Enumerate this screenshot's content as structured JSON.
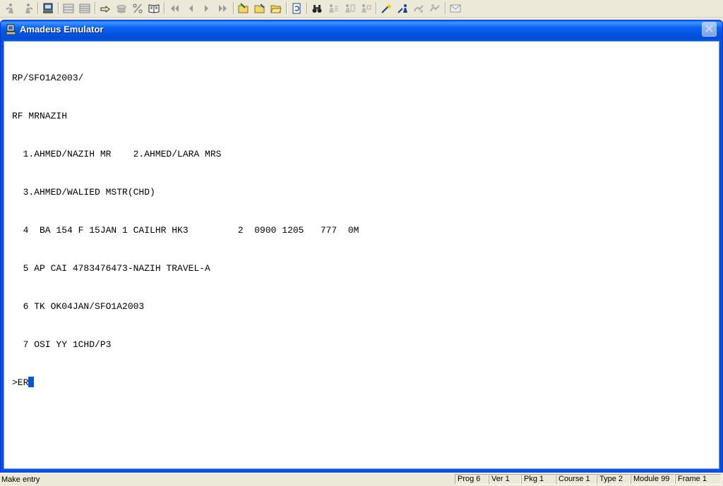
{
  "toolbar": {
    "buttons": [
      {
        "icon": "figure-left-icon"
      },
      {
        "icon": "figure-right-icon"
      },
      {
        "icon": "terminal-icon"
      },
      {
        "icon": "grid-icon"
      },
      {
        "icon": "grid-alt-icon"
      },
      {
        "icon": "hand-pointer-icon"
      },
      {
        "icon": "coins-icon"
      },
      {
        "icon": "percent-icon"
      },
      {
        "icon": "open-book-icon"
      },
      {
        "icon": "first-page-icon"
      },
      {
        "icon": "previous-page-icon"
      },
      {
        "icon": "next-page-icon"
      },
      {
        "icon": "last-page-icon"
      },
      {
        "icon": "folder-arrow-icon"
      },
      {
        "icon": "folder-edit-icon"
      },
      {
        "icon": "folder-open-icon"
      },
      {
        "icon": "refresh-page-icon"
      },
      {
        "icon": "binoculars-icon"
      },
      {
        "icon": "figure-tools-icon"
      },
      {
        "icon": "figure-exchange-icon"
      },
      {
        "icon": "figure-network-icon"
      },
      {
        "icon": "magic-wand-icon"
      },
      {
        "icon": "wand-figure-icon"
      },
      {
        "icon": "hands-icon"
      },
      {
        "icon": "hands-alt-icon"
      },
      {
        "icon": "envelope-icon"
      }
    ]
  },
  "window": {
    "title": "Amadeus Emulator",
    "icon": "computer-icon",
    "close_icon": "close-icon"
  },
  "terminal": {
    "lines": [
      "RP/SFO1A2003/",
      "RF MRNAZIH",
      "  1.AHMED/NAZIH MR    2.AHMED/LARA MRS",
      "  3.AHMED/WALIED MSTR(CHD)",
      "  4  BA 154 F 15JAN 1 CAILHR HK3         2  0900 1205   777  0M",
      "  5 AP CAI 4783476473-NAZIH TRAVEL-A",
      "  6 TK OK04JAN/SFO1A2003",
      "  7 OSI YY 1CHD/P3"
    ],
    "input_line": ">ER"
  },
  "status": {
    "message": "Make entry",
    "prog": "Prog 6",
    "ver": "Ver 1",
    "pkg": "Pkg 1",
    "course": "Course 1",
    "type": "Type 2",
    "module": "Module 99",
    "frame": "Frame 1"
  },
  "colors": {
    "titlebar": "#0054e3",
    "cursor": "#0a54d8",
    "terminal_bg": "#ffffff",
    "chrome": "#ece9d8"
  }
}
